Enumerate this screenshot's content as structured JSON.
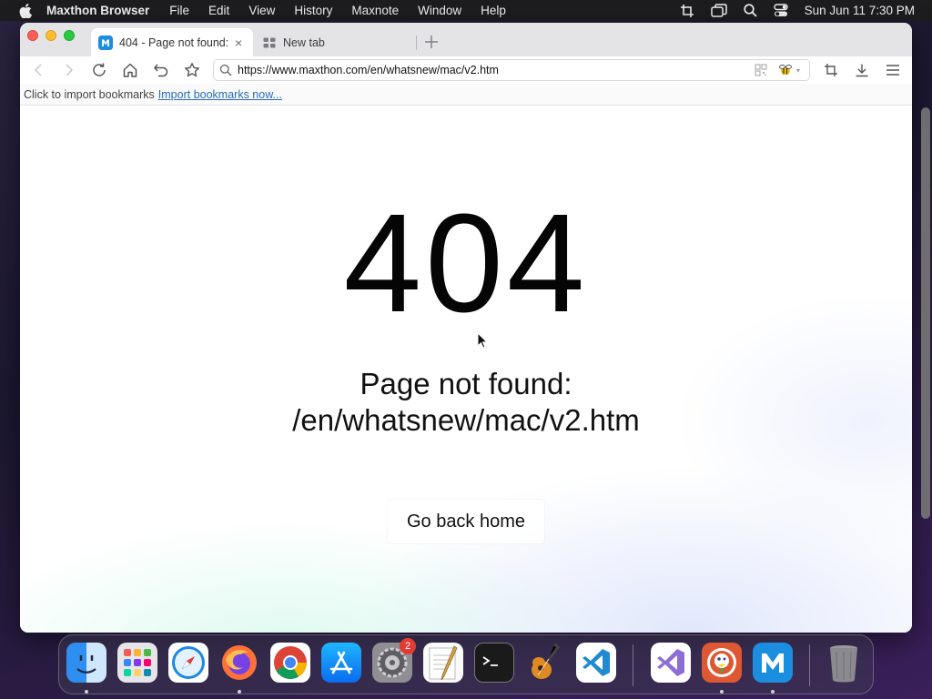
{
  "menubar": {
    "app_name": "Maxthon Browser",
    "items": [
      "File",
      "Edit",
      "View",
      "History",
      "Maxnote",
      "Window",
      "Help"
    ],
    "clock": "Sun Jun 11  7:30 PM"
  },
  "browser": {
    "tabs": [
      {
        "title": "404 - Page not found:",
        "active": true
      },
      {
        "title": "New tab",
        "active": false
      }
    ],
    "url": "https://www.maxthon.com/en/whatsnew/mac/v2.htm",
    "bookmark_bar": {
      "prompt": "Click to import bookmarks",
      "link": "Import bookmarks now..."
    }
  },
  "page": {
    "error_code": "404",
    "message_line1": "Page not found:",
    "message_line2": "/en/whatsnew/mac/v2.htm",
    "home_button": "Go back home"
  },
  "dock": {
    "apps": [
      "Finder",
      "Launchpad",
      "Safari",
      "Firefox",
      "Chrome",
      "App Store",
      "System Preferences",
      "TextEdit",
      "Terminal",
      "GarageBand",
      "Visual Studio Code",
      "Visual Studio",
      "DuckDuckGo",
      "Maxthon",
      "Trash"
    ],
    "badge_count": "2"
  },
  "colors": {
    "accent_link": "#2a6ab8",
    "close": "#fe5f57",
    "minimize": "#febc2e",
    "maximize": "#28c840",
    "badge": "#e23b34"
  }
}
